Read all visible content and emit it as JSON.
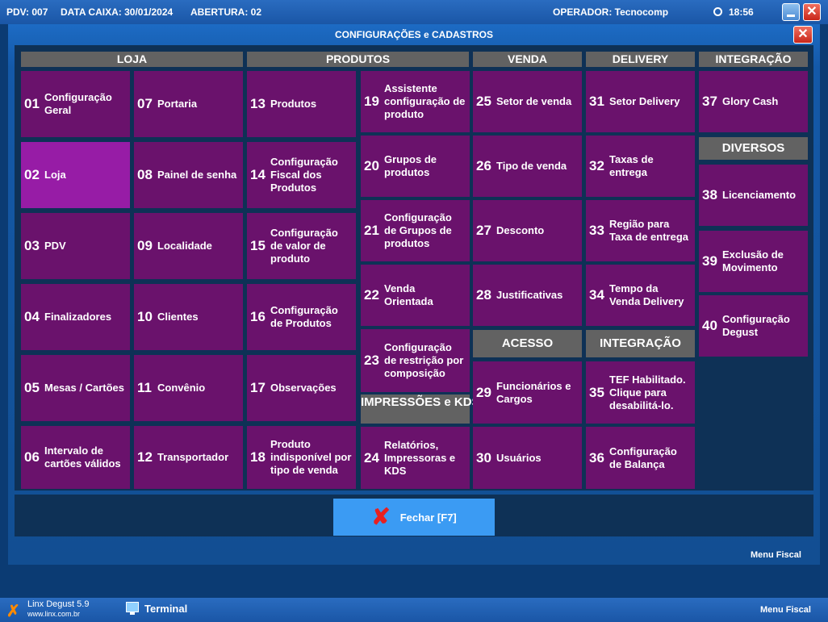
{
  "topbar": {
    "pdv": "PDV: 007",
    "data_caixa": "DATA CAIXA: 30/01/2024",
    "abertura": "ABERTURA: 02",
    "operador": "OPERADOR: Tecnocomp",
    "time": "18:56"
  },
  "dialog": {
    "title": "CONFIGURAÇÕES e CADASTROS",
    "close_glyph": "✕"
  },
  "sections": {
    "loja": "LOJA",
    "produtos": "PRODUTOS",
    "venda": "VENDA",
    "delivery": "DELIVERY",
    "integracao": "INTEGRAÇÃO",
    "diversos": "DIVERSOS",
    "impressoes": "IMPRESSÕES e KDS",
    "acesso": "ACESSO",
    "integracao2": "INTEGRAÇÃO"
  },
  "tiles": [
    {
      "num": "01",
      "label": "Configuração Geral"
    },
    {
      "num": "02",
      "label": "Loja"
    },
    {
      "num": "03",
      "label": "PDV"
    },
    {
      "num": "04",
      "label": "Finalizadores"
    },
    {
      "num": "05",
      "label": "Mesas / Cartões"
    },
    {
      "num": "06",
      "label": "Intervalo de cartões válidos"
    },
    {
      "num": "07",
      "label": "Portaria"
    },
    {
      "num": "08",
      "label": "Painel de senha"
    },
    {
      "num": "09",
      "label": "Localidade"
    },
    {
      "num": "10",
      "label": "Clientes"
    },
    {
      "num": "11",
      "label": "Convênio"
    },
    {
      "num": "12",
      "label": "Transportador"
    },
    {
      "num": "13",
      "label": "Produtos"
    },
    {
      "num": "14",
      "label": "Configuração Fiscal dos Produtos"
    },
    {
      "num": "15",
      "label": "Configuração de valor de produto"
    },
    {
      "num": "16",
      "label": "Configuração de Produtos"
    },
    {
      "num": "17",
      "label": "Observações"
    },
    {
      "num": "18",
      "label": "Produto indisponível por tipo de venda"
    },
    {
      "num": "19",
      "label": "Assistente configuração de produto"
    },
    {
      "num": "20",
      "label": "Grupos de produtos"
    },
    {
      "num": "21",
      "label": "Configuração de Grupos de produtos"
    },
    {
      "num": "22",
      "label": "Venda Orientada"
    },
    {
      "num": "23",
      "label": "Configuração de restrição por composição"
    },
    {
      "num": "24",
      "label": "Relatórios, Impressoras e KDS"
    },
    {
      "num": "25",
      "label": "Setor de venda"
    },
    {
      "num": "26",
      "label": "Tipo de venda"
    },
    {
      "num": "27",
      "label": "Desconto"
    },
    {
      "num": "28",
      "label": "Justificativas"
    },
    {
      "num": "29",
      "label": "Funcionários e Cargos"
    },
    {
      "num": "30",
      "label": "Usuários"
    },
    {
      "num": "31",
      "label": "Setor Delivery"
    },
    {
      "num": "32",
      "label": "Taxas de entrega"
    },
    {
      "num": "33",
      "label": "Região para Taxa de entrega"
    },
    {
      "num": "34",
      "label": "Tempo da Venda Delivery"
    },
    {
      "num": "35",
      "label": "TEF Habilitado. Clique para desabilitá-lo."
    },
    {
      "num": "36",
      "label": "Configuração de Balança"
    },
    {
      "num": "37",
      "label": "Glory Cash"
    },
    {
      "num": "38",
      "label": "Licenciamento"
    },
    {
      "num": "39",
      "label": "Exclusão de Movimento"
    },
    {
      "num": "40",
      "label": "Configuração Degust"
    }
  ],
  "buttons": {
    "fechar": "Fechar [F7]",
    "menu_fiscal": "Menu Fiscal"
  },
  "bottombar": {
    "app_name": "Linx Degust 5.9",
    "url": "www.linx.com.br",
    "terminal": "Terminal",
    "menu_fiscal": "Menu Fiscal"
  },
  "icons": {
    "close": "close-icon",
    "minimize": "minimize-icon",
    "clock": "clock-icon",
    "fechar": "x-icon",
    "linx": "linx-logo-icon",
    "terminal": "monitor-icon"
  },
  "colors": {
    "tile": "#6a126c",
    "tile_selected": "#971ca6",
    "header": "#626262",
    "fechar_button": "#3b9bf3",
    "titlebar": "#1a56a6"
  },
  "selected_tile": "02"
}
